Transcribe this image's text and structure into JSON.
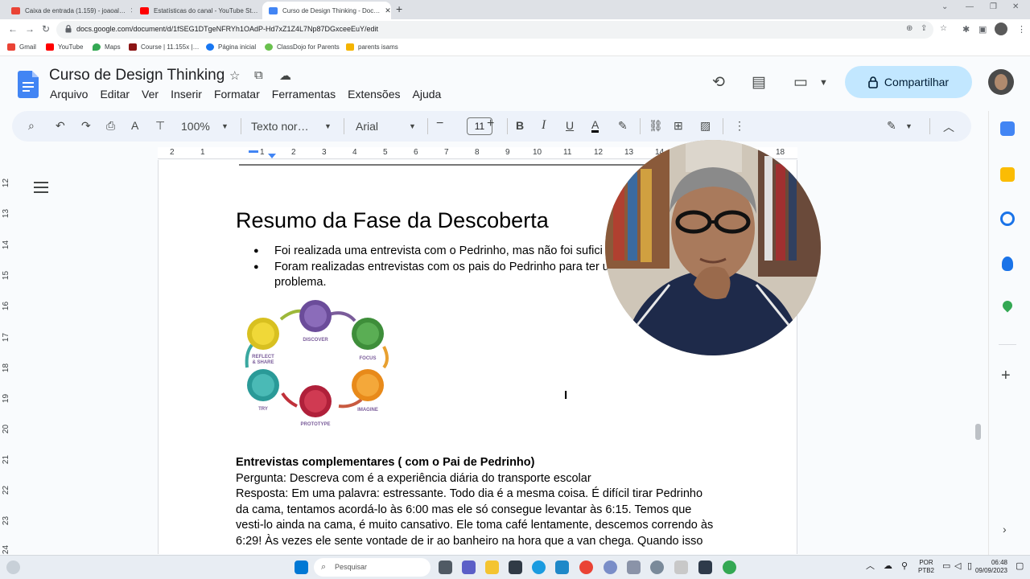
{
  "browser": {
    "tabs": [
      {
        "title": "Caixa de entrada (1.159) - joaoal…",
        "favicon_color": "#ea4335"
      },
      {
        "title": "Estatísticas do canal - YouTube St…",
        "favicon_color": "#ff0000"
      },
      {
        "title": "Curso de Design Thinking - Doc…",
        "favicon_color": "#4285f4"
      }
    ],
    "url": "docs.google.com/document/d/1fSEG1DTgeNFRYh1OAdP-Hd7xZ1Z4L7Np87DGxceeEuY/edit",
    "bookmarks": [
      {
        "label": "Gmail",
        "color": "#ea4335"
      },
      {
        "label": "YouTube",
        "color": "#ff0000"
      },
      {
        "label": "Maps",
        "color": "#34a853"
      },
      {
        "label": "Course | 11.155x |…",
        "color": "#8c1515"
      },
      {
        "label": "Página inicial",
        "color": "#1877f2"
      },
      {
        "label": "ClassDojo for Parents",
        "color": "#6ac14e"
      },
      {
        "label": "parents isams",
        "color": "#f4b400"
      }
    ]
  },
  "docs": {
    "title": "Curso de Design Thinking",
    "menu": [
      "Arquivo",
      "Editar",
      "Ver",
      "Inserir",
      "Formatar",
      "Ferramentas",
      "Extensões",
      "Ajuda"
    ],
    "share_label": "Compartilhar",
    "toolbar": {
      "zoom": "100%",
      "style": "Texto nor…",
      "font": "Arial",
      "font_size": "11"
    },
    "ruler": {
      "numbers": [
        "2",
        "1",
        "1",
        "2",
        "3",
        "4",
        "5",
        "6",
        "7",
        "8",
        "9",
        "10",
        "11",
        "12",
        "13",
        "14",
        "18"
      ]
    },
    "vruler": [
      "12",
      "13",
      "14",
      "15",
      "16",
      "17",
      "18",
      "19",
      "20",
      "21",
      "22",
      "23",
      "24"
    ]
  },
  "document": {
    "heading": "Resumo da Fase da Descoberta",
    "bullets": [
      "Foi realizada uma entrevista com o Pedrinho, mas não foi sufici",
      "Foram realizadas entrevistas com os pais do Pedrinho para ter u"
    ],
    "bullet_continuation": "problema.",
    "diagram_labels": [
      "DISCOVER",
      "FOCUS",
      "IMAGINE",
      "PROTOTYPE",
      "TRY",
      "REFLECT",
      "& SHARE"
    ],
    "section_title": "Entrevistas complementares ( com o Pai de Pedrinho)",
    "question": "Pergunta: Descreva com é a experiência diária do transporte escolar",
    "answer_lines": [
      "Resposta: Em uma palavra: estressante. Todo dia é a mesma coisa. É difícil tirar Pedrinho",
      "da cama, tentamos acordá-lo às 6:00 mas ele só consegue levantar às 6:15. Temos que",
      "vesti-lo ainda na cama, é muito cansativo. Ele toma café lentamente, descemos correndo às",
      "6:29! Às vezes ele sente vontade de ir ao banheiro na hora que a van chega. Quando isso"
    ]
  },
  "taskbar": {
    "search_placeholder": "Pesquisar",
    "language": "POR",
    "layout": "PTB2",
    "time": "06:48",
    "date": "09/09/2023"
  }
}
